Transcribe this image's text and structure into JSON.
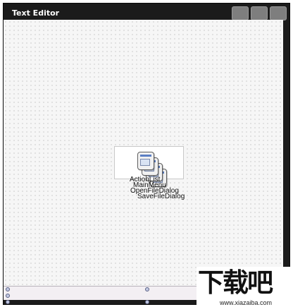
{
  "window": {
    "title": "Text Editor"
  },
  "components": [
    {
      "label": "ActionList"
    },
    {
      "label": "MainMenu"
    },
    {
      "label": "OpenFileDialog"
    },
    {
      "label": "SaveFileDialog"
    }
  ],
  "watermark": {
    "main": "下载吧",
    "url": "www.xiazaiba.com"
  }
}
